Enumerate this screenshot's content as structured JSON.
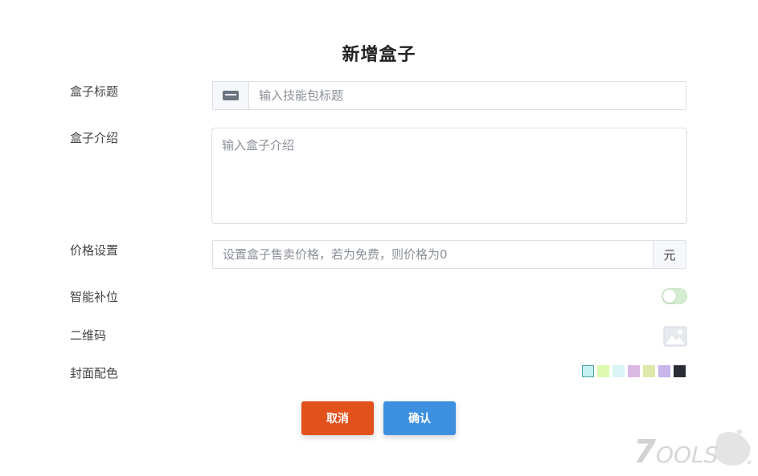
{
  "page_title": "新增盒子",
  "form": {
    "title_label": "盒子标题",
    "title_placeholder": "输入技能包标题",
    "title_icon": "card-icon",
    "intro_label": "盒子介绍",
    "intro_placeholder": "输入盒子介绍",
    "price_label": "价格设置",
    "price_placeholder": "设置盒子售卖价格，若为免费，则价格为0",
    "price_suffix": "元",
    "smart_fill_label": "智能补位",
    "smart_fill_enabled": false,
    "qrcode_label": "二维码",
    "qrcode_icon": "image-placeholder-icon",
    "cover_color_label": "封面配色",
    "cover_colors": [
      "#c5f0f0",
      "#ddf9b0",
      "#d8f4f4",
      "#dcb8e4",
      "#dde9a8",
      "#c7b4ea",
      "#2a2d33"
    ],
    "selected_color_index": 0
  },
  "actions": {
    "cancel_label": "取消",
    "confirm_label": "确认",
    "cancel_color": "#e2501c",
    "confirm_color": "#3d8fe0"
  },
  "watermark": {
    "text": "7OOLS"
  }
}
